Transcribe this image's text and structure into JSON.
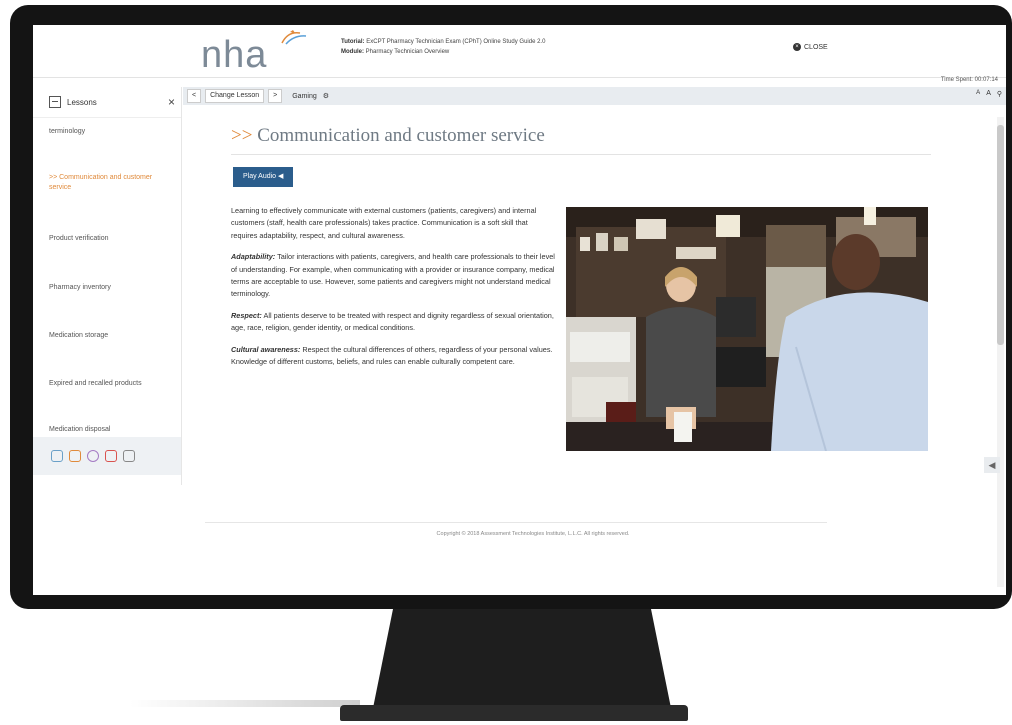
{
  "header": {
    "logo_text": "nha",
    "tutorial_label": "Tutorial:",
    "tutorial_value": "ExCPT Pharmacy Technician Exam (CPhT) Online Study Guide 2.0",
    "module_label": "Module:",
    "module_value": "Pharmacy Technician Overview",
    "close_label": "CLOSE",
    "time_spent": "Time Spent: 00:07:14"
  },
  "sidebar": {
    "title": "Lessons",
    "close_icon": "×",
    "items": [
      {
        "label": "terminology"
      },
      {
        "label": ">> Communication and customer service"
      },
      {
        "label": "Product verification"
      },
      {
        "label": "Pharmacy inventory"
      },
      {
        "label": "Medication storage"
      },
      {
        "label": "Expired and recalled products"
      },
      {
        "label": "Medication disposal"
      }
    ],
    "tools": [
      "notes-icon",
      "bookmark-icon",
      "glossary-icon",
      "flashcard-icon",
      "calculator-icon"
    ]
  },
  "toolbar": {
    "prev_icon": "<",
    "change_lesson": "Change Lesson",
    "next_icon": ">",
    "gaming_label": "Gaming",
    "gaming_icon": "⚙",
    "font_smaller": "A",
    "font_larger": "A",
    "search_icon": "⚲"
  },
  "main": {
    "title_prefix": ">>",
    "title": "Communication and customer service",
    "play_audio": "Play Audio ◀",
    "para1": "Learning to effectively communicate with external customers (patients, caregivers) and internal customers (staff, health care professionals) takes practice. Communication is a soft skill that requires adaptability, respect, and cultural awareness.",
    "para2_term": "Adaptability:",
    "para2": " Tailor interactions with patients, caregivers, and health care professionals to their level of understanding. For example, when communicating with a provider or insurance company, medical terms are acceptable to use. However, some patients and caregivers might not understand medical terminology.",
    "para3_term": "Respect:",
    "para3": " All patients deserve to be treated with respect and dignity regardless of sexual orientation, age, race, religion, gender identity, or medical conditions.",
    "para4_term": "Cultural awareness:",
    "para4": " Respect the cultural differences of others, regardless of your personal values. Knowledge of different customs, beliefs, and rules can enable culturally competent care.",
    "copyright": "Copyright © 2018 Assessment Technologies Institute, L.L.C. All rights reserved."
  },
  "colors": {
    "accent": "#e08a3b",
    "audio_button": "#2b5d8c",
    "logo": "#7d8a97"
  }
}
